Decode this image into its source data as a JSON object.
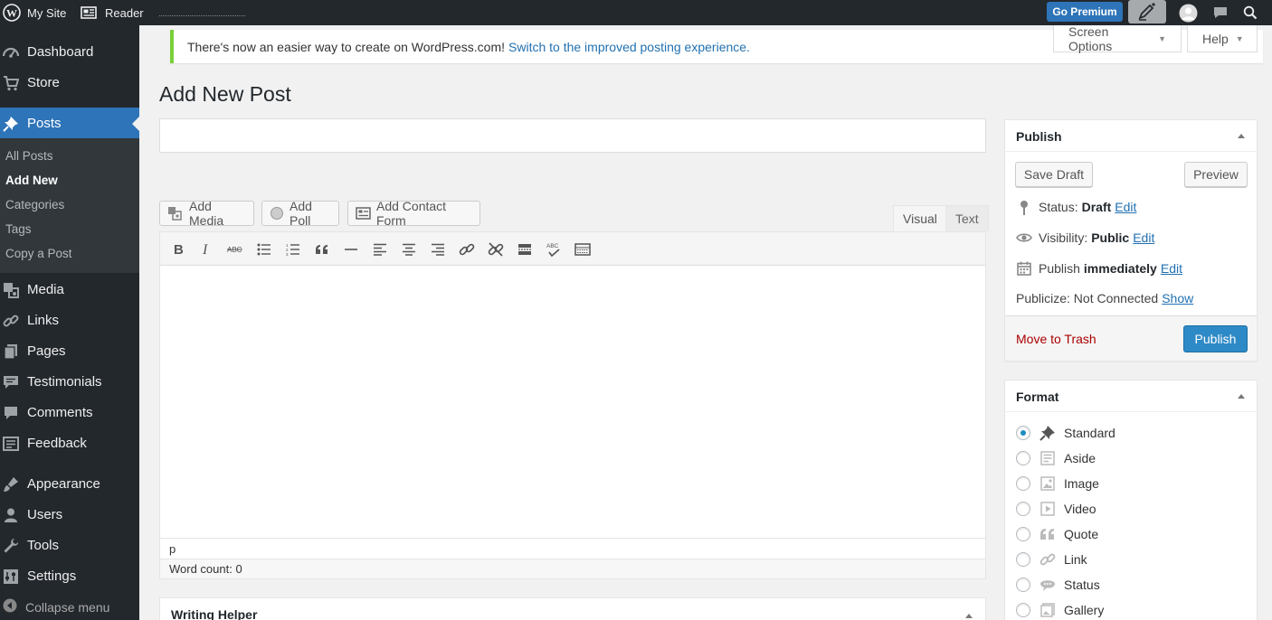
{
  "adminbar": {
    "my_site": "My Site",
    "reader": "Reader",
    "go_premium": "Go Premium"
  },
  "menu": {
    "items_top": [
      {
        "label": "Dashboard",
        "icon": "dashboard-icon"
      },
      {
        "label": "Store",
        "icon": "cart-icon"
      },
      {
        "label": "Posts",
        "icon": "pin-icon"
      }
    ],
    "submenu": [
      "All Posts",
      "Add New",
      "Categories",
      "Tags",
      "Copy a Post"
    ],
    "items_bottom": [
      {
        "label": "Media",
        "icon": "media-icon"
      },
      {
        "label": "Links",
        "icon": "links-icon"
      },
      {
        "label": "Pages",
        "icon": "pages-icon"
      },
      {
        "label": "Testimonials",
        "icon": "testimonials-icon"
      },
      {
        "label": "Comments",
        "icon": "comments-icon"
      },
      {
        "label": "Feedback",
        "icon": "feedback-icon"
      },
      {
        "label": "Appearance",
        "icon": "appearance-icon"
      },
      {
        "label": "Users",
        "icon": "users-icon"
      },
      {
        "label": "Tools",
        "icon": "tools-icon"
      },
      {
        "label": "Settings",
        "icon": "settings-icon"
      }
    ],
    "collapse": "Collapse menu"
  },
  "notice": {
    "text": "There's now an easier way to create on WordPress.com!",
    "link": "Switch to the improved posting experience."
  },
  "screen_meta": {
    "screen_options": "Screen Options",
    "help": "Help"
  },
  "page": {
    "title": "Add New Post"
  },
  "editor": {
    "title_value": "",
    "add_media": "Add Media",
    "add_poll": "Add Poll",
    "add_contact_form": "Add Contact Form",
    "tab_visual": "Visual",
    "tab_text": "Text",
    "toolbar": [
      "bold-icon",
      "italic-icon",
      "strikethrough-icon",
      "bulleted-list-icon",
      "numbered-list-icon",
      "blockquote-icon",
      "horizontal-line-icon",
      "align-left-icon",
      "align-center-icon",
      "align-right-icon",
      "insert-link-icon",
      "remove-link-icon",
      "read-more-icon",
      "spellcheck-icon",
      "toolbar-toggle-icon"
    ],
    "path": "p",
    "word_count": "Word count: 0"
  },
  "writing_helper": {
    "title": "Writing Helper"
  },
  "publish": {
    "title": "Publish",
    "save_draft": "Save Draft",
    "preview": "Preview",
    "status_label": "Status:",
    "status_value": "Draft",
    "visibility_label": "Visibility:",
    "visibility_value": "Public",
    "publish_label": "Publish",
    "publish_value": "immediately",
    "publicize_label": "Publicize: Not Connected",
    "edit": "Edit",
    "show": "Show",
    "trash": "Move to Trash",
    "publish_button": "Publish"
  },
  "format": {
    "title": "Format",
    "options": [
      "Standard",
      "Aside",
      "Image",
      "Video",
      "Quote",
      "Link",
      "Status",
      "Gallery"
    ],
    "selected": "Standard"
  }
}
